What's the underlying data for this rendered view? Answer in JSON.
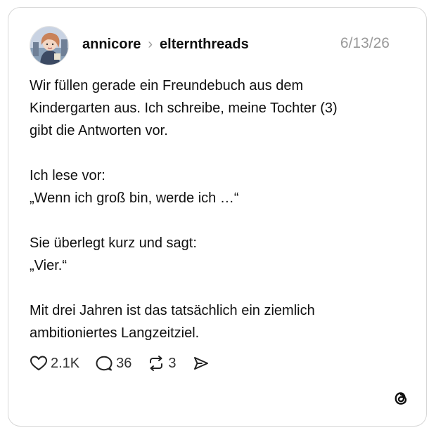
{
  "post": {
    "username": "annicore",
    "separator": "›",
    "community": "elternthreads",
    "date": "6/13/26",
    "body": {
      "p1_line1": "Wir füllen gerade ein Freundebuch aus dem",
      "p1_line2": "Kindergarten aus. Ich schreibe, meine Tochter (3)",
      "p1_line3": "gibt die Antworten vor.",
      "p2_line1": "Ich lese vor:",
      "p2_line2": "„Wenn ich groß bin, werde ich …“",
      "p3_line1": "Sie überlegt kurz und sagt:",
      "p3_line2": "„Vier.“",
      "p4_line1": "Mit drei Jahren ist das tatsächlich ein ziemlich",
      "p4_line2": "ambitioniertes Langzeitziel."
    },
    "actions": {
      "likes": "2.1K",
      "comments": "36",
      "reposts": "3"
    }
  },
  "icons": {
    "like": "heart-icon",
    "comment": "comment-bubble-icon",
    "repost": "repost-icon",
    "share": "share-send-icon",
    "brand": "threads-logo-icon"
  }
}
